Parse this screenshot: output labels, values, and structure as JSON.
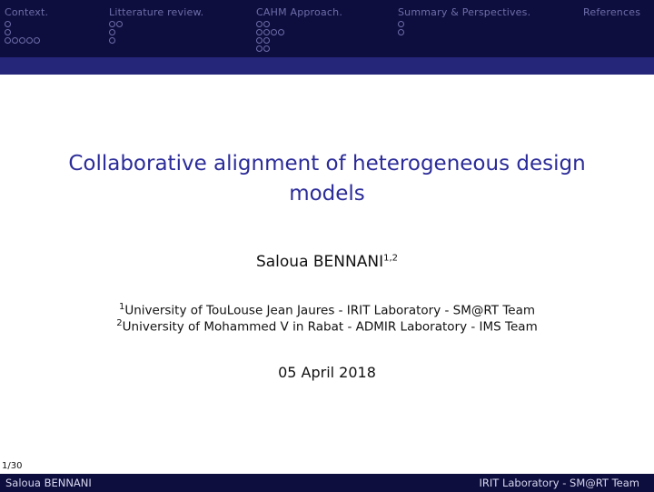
{
  "nav": [
    {
      "title": "Context.",
      "dots": [
        1,
        1,
        5
      ]
    },
    {
      "title": "Litterature review.",
      "dots": [
        2,
        1,
        1
      ]
    },
    {
      "title": "CAHM Approach.",
      "dots": [
        2,
        4,
        2,
        2
      ]
    },
    {
      "title": "Summary & Perspectives.",
      "dots": [
        1,
        1
      ]
    },
    {
      "title": "References",
      "dots": []
    }
  ],
  "slide": {
    "title": "Collaborative alignment of heterogeneous design models",
    "author": "Saloua BENNANI",
    "author_sup": "1,2",
    "affiliations": [
      {
        "sup": "1",
        "text": "University of TouLouse Jean Jaures - IRIT Laboratory - SM@RT Team"
      },
      {
        "sup": "2",
        "text": "University of Mohammed V in Rabat - ADMIR Laboratory - IMS Team"
      }
    ],
    "date": "05 April 2018"
  },
  "page_number": "1/30",
  "footer": {
    "left": "Saloua BENNANI",
    "right": "IRIT Laboratory - SM@RT Team"
  }
}
